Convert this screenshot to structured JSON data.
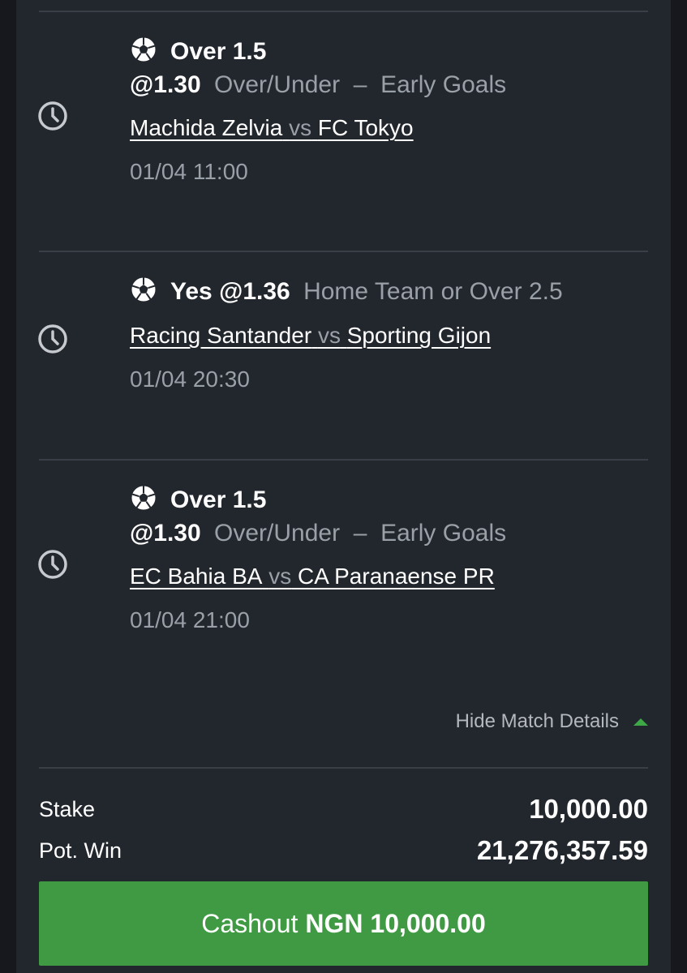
{
  "legs": [
    {
      "icon": "soccer-ball-icon",
      "pick": "Over 1.5",
      "odds": "@1.30",
      "market": "Over/Under  –  Early Goals",
      "home": "Machida Zelvia",
      "vs": "vs",
      "away": "FC Tokyo",
      "kickoff": "01/04 11:00"
    },
    {
      "icon": "soccer-ball-icon",
      "pick": "Yes",
      "odds": "@1.36",
      "market": "Home Team or Over 2.5",
      "home": "Racing Santander",
      "vs": "vs",
      "away": "Sporting Gijon",
      "kickoff": "01/04 20:30"
    },
    {
      "icon": "soccer-ball-icon",
      "pick": "Over 1.5",
      "odds": "@1.30",
      "market": "Over/Under  –  Early Goals",
      "home": "EC Bahia BA",
      "vs": "vs",
      "away": "CA Paranaense PR",
      "kickoff": "01/04 21:00"
    }
  ],
  "hide_details_label": "Hide Match Details",
  "summary": {
    "stake_label": "Stake",
    "stake_value": "10,000.00",
    "potwin_label": "Pot. Win",
    "potwin_value": "21,276,357.59"
  },
  "cashout": {
    "label": "Cashout",
    "amount": "NGN 10,000.00"
  },
  "colors": {
    "background": "#22262d",
    "accent_green": "#3f9a43",
    "muted_text": "#9aa0a8"
  }
}
